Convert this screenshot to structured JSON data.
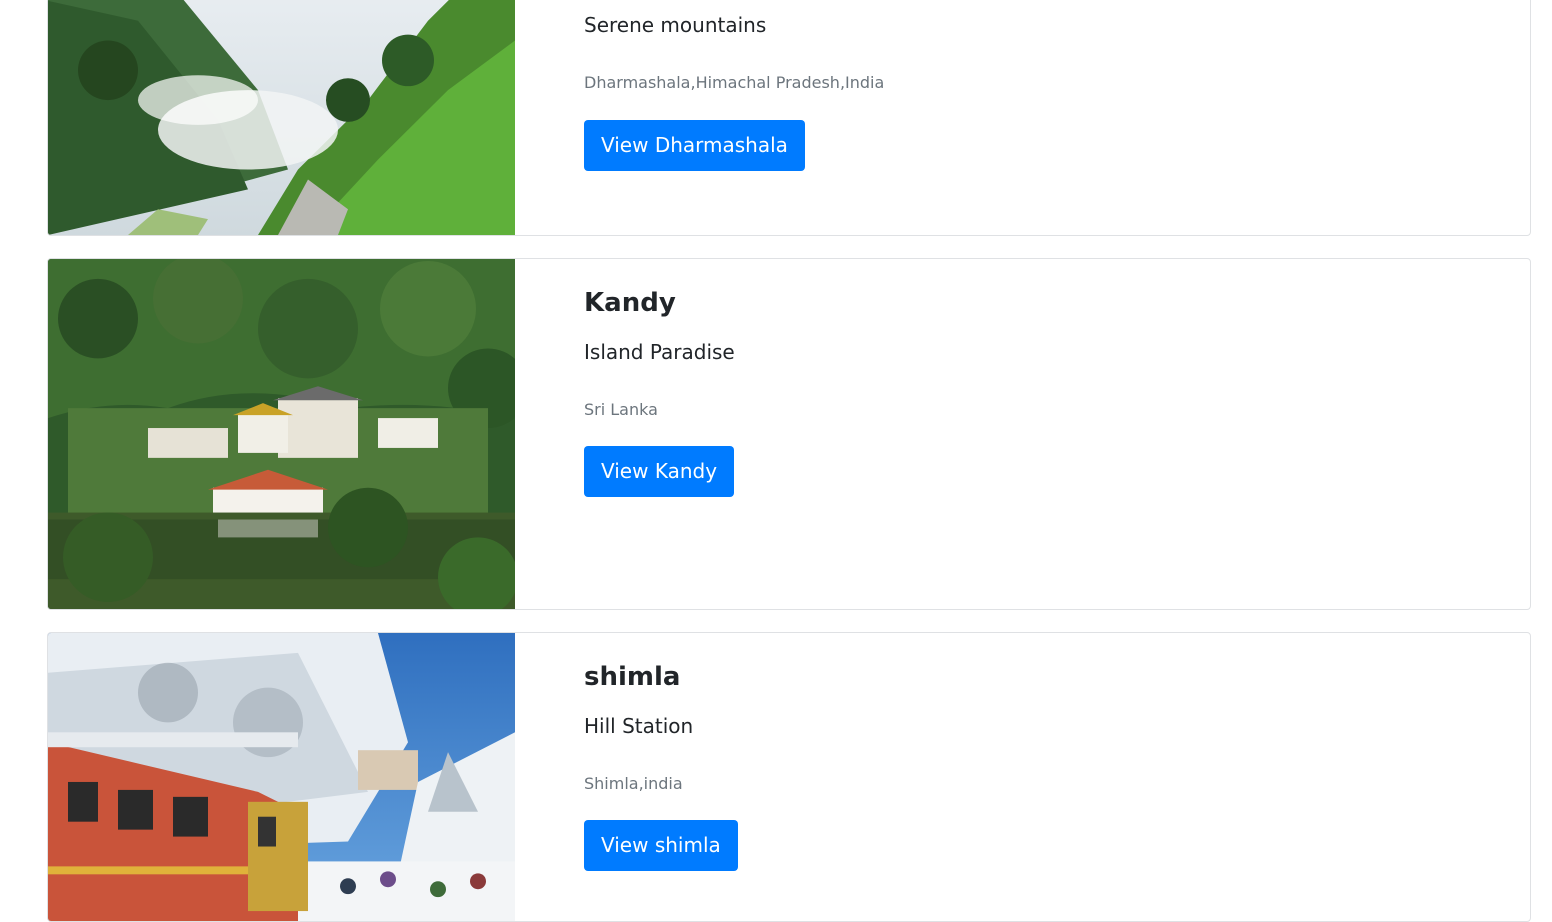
{
  "cards": [
    {
      "title": "",
      "subtitle": "Serene mountains",
      "location": "Dharmashala,Himachal Pradesh,India",
      "button_label": "View Dharmashala",
      "image": "mountain-valley-photo"
    },
    {
      "title": "Kandy",
      "subtitle": "Island Paradise",
      "location": "Sri Lanka",
      "button_label": "View Kandy",
      "image": "lake-temple-photo"
    },
    {
      "title": "shimla",
      "subtitle": "Hill Station",
      "location": "Shimla,india",
      "button_label": "View shimla",
      "image": "snow-train-photo"
    }
  ],
  "colors": {
    "primary": "#007bff",
    "muted": "#6c757d",
    "border": "#dfe1e4"
  }
}
